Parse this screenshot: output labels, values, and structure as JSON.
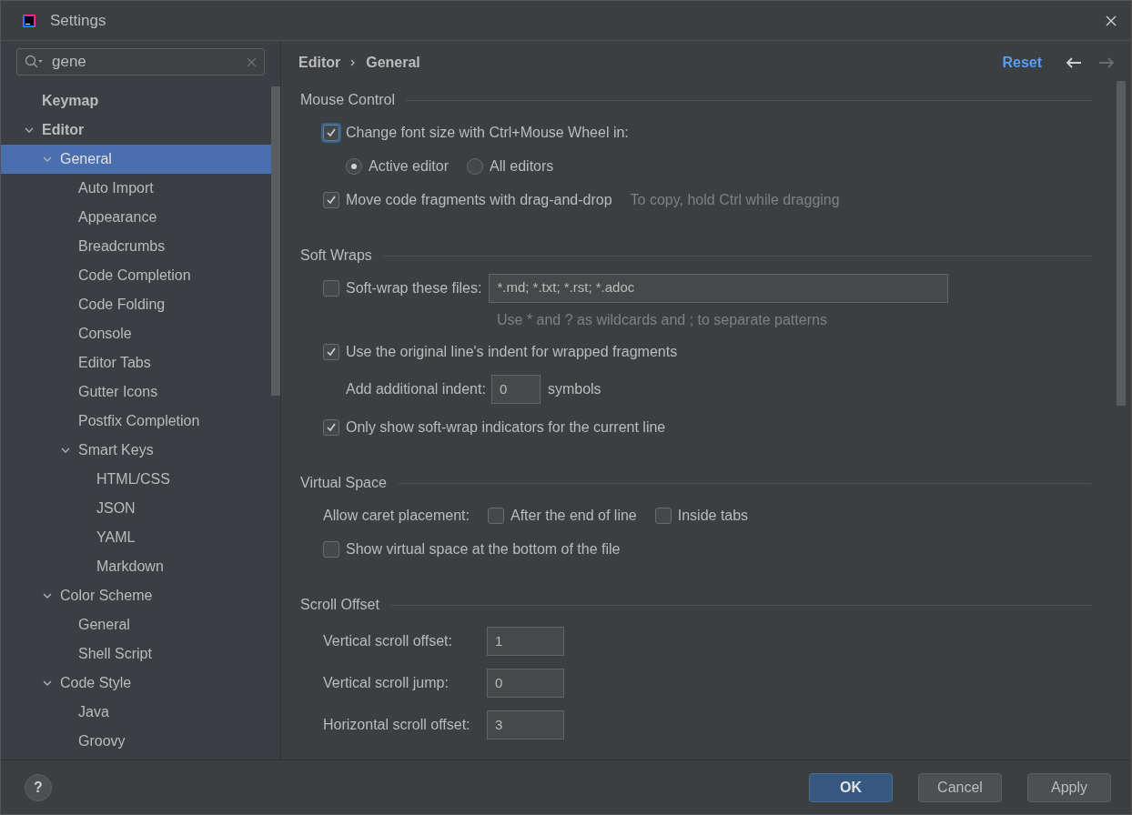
{
  "window": {
    "title": "Settings"
  },
  "search": {
    "value": "gene"
  },
  "tree": [
    {
      "label": "Keymap",
      "bold": true,
      "selected": false
    },
    {
      "label": "Editor",
      "bold": true,
      "selected": false,
      "expanded": true,
      "children": [
        {
          "label": "General",
          "selected": true,
          "expanded": true,
          "children": [
            {
              "label": "Auto Import",
              "selected": false
            },
            {
              "label": "Appearance",
              "selected": false
            },
            {
              "label": "Breadcrumbs",
              "selected": false
            },
            {
              "label": "Code Completion",
              "selected": false
            },
            {
              "label": "Code Folding",
              "selected": false
            },
            {
              "label": "Console",
              "selected": false
            },
            {
              "label": "Editor Tabs",
              "selected": false
            },
            {
              "label": "Gutter Icons",
              "selected": false
            },
            {
              "label": "Postfix Completion",
              "selected": false
            },
            {
              "label": "Smart Keys",
              "selected": false,
              "expanded": true,
              "children": [
                {
                  "label": "HTML/CSS",
                  "selected": false
                },
                {
                  "label": "JSON",
                  "selected": false
                },
                {
                  "label": "YAML",
                  "selected": false
                },
                {
                  "label": "Markdown",
                  "selected": false
                }
              ]
            }
          ]
        },
        {
          "label": "Color Scheme",
          "selected": false,
          "expanded": true,
          "children": [
            {
              "label": "General",
              "selected": false
            },
            {
              "label": "Shell Script",
              "selected": false
            }
          ]
        },
        {
          "label": "Code Style",
          "selected": false,
          "expanded": true,
          "children": [
            {
              "label": "Java",
              "selected": false
            },
            {
              "label": "Groovy",
              "selected": false
            }
          ]
        }
      ]
    }
  ],
  "breadcrumb": [
    "Editor",
    "General"
  ],
  "reset": "Reset",
  "sections": [
    {
      "title": "Mouse Control",
      "items": [
        {
          "kind": "checkbox",
          "label": "Change font size with Ctrl+Mouse Wheel in:",
          "checked": true,
          "focused": true
        },
        {
          "kind": "radios",
          "options": [
            {
              "label": "Active editor",
              "selected": true
            },
            {
              "label": "All editors",
              "selected": false
            }
          ]
        },
        {
          "kind": "checkbox",
          "label": "Move code fragments with drag-and-drop",
          "checked": true,
          "focused": false,
          "hint": "To copy, hold Ctrl while dragging"
        }
      ]
    },
    {
      "title": "Soft Wraps",
      "items": [
        {
          "kind": "checkbox",
          "label": "Soft-wrap these files:",
          "checked": false,
          "focused": false,
          "value": "*.md; *.txt; *.rst; *.adoc"
        },
        {
          "kind": "hint",
          "text": "Use * and ? as wildcards and ; to separate patterns"
        },
        {
          "kind": "checkbox",
          "label": "Use the original line's indent for wrapped fragments",
          "checked": true,
          "focused": false
        },
        {
          "kind": "indent_field",
          "label": "Add additional indent:",
          "value": "0",
          "suffix": "symbols"
        },
        {
          "kind": "checkbox",
          "label": "Only show soft-wrap indicators for the current line",
          "checked": true,
          "focused": false
        }
      ]
    },
    {
      "title": "Virtual Space",
      "items": [
        {
          "kind": "checkbox_group",
          "label": "Allow caret placement:",
          "options": [
            {
              "label": "After the end of line",
              "checked": false
            },
            {
              "label": "Inside tabs",
              "checked": false
            }
          ]
        },
        {
          "kind": "checkbox",
          "label": "Show virtual space at the bottom of the file",
          "checked": false,
          "focused": false
        }
      ]
    },
    {
      "title": "Scroll Offset",
      "items": [
        {
          "kind": "field",
          "label": "Vertical scroll offset:",
          "value": "1"
        },
        {
          "kind": "field",
          "label": "Vertical scroll jump:",
          "value": "0"
        },
        {
          "kind": "field",
          "label": "Horizontal scroll offset:",
          "value": "3"
        }
      ]
    }
  ],
  "help": "?",
  "buttons": [
    {
      "label": "OK",
      "default": true
    },
    {
      "label": "Cancel",
      "default": false
    },
    {
      "label": "Apply",
      "default": false
    }
  ]
}
